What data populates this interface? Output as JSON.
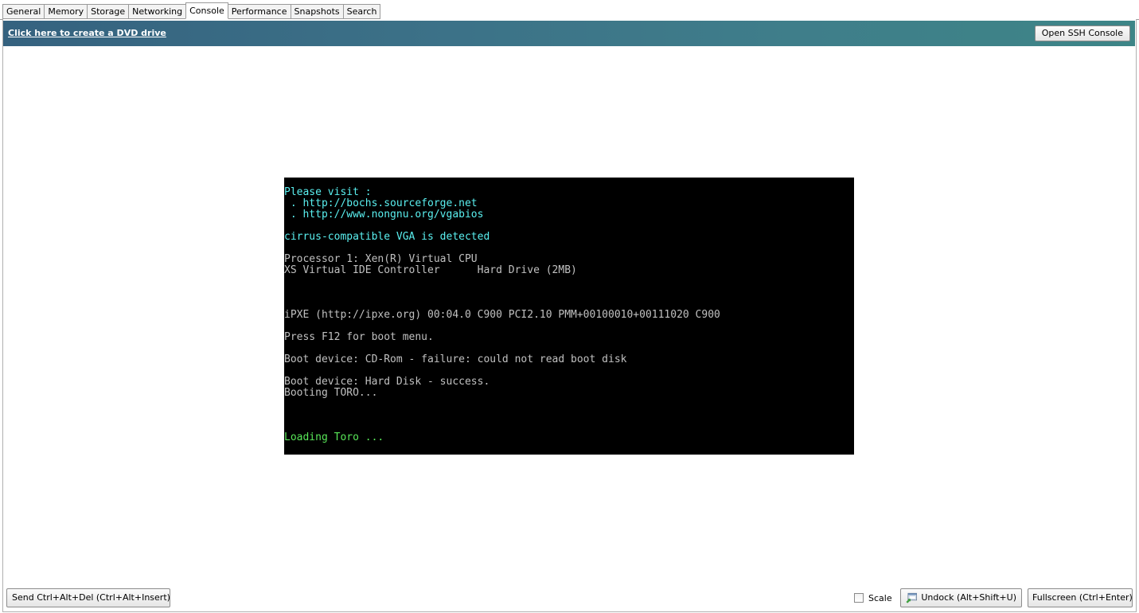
{
  "tabs": [
    {
      "label": "General",
      "active": false
    },
    {
      "label": "Memory",
      "active": false
    },
    {
      "label": "Storage",
      "active": false
    },
    {
      "label": "Networking",
      "active": false
    },
    {
      "label": "Console",
      "active": true
    },
    {
      "label": "Performance",
      "active": false
    },
    {
      "label": "Snapshots",
      "active": false
    },
    {
      "label": "Search",
      "active": false
    }
  ],
  "banner": {
    "link_text": "Click here to create a DVD drive",
    "ssh_button": "Open SSH Console",
    "colors": {
      "start": "#35627f",
      "end": "#3d8587"
    }
  },
  "console": {
    "lines": [
      {
        "text": "Please visit :",
        "color": "cyan"
      },
      {
        "text": " . http://bochs.sourceforge.net",
        "color": "cyan"
      },
      {
        "text": " . http://www.nongnu.org/vgabios",
        "color": "cyan"
      },
      {
        "text": "",
        "color": "gray"
      },
      {
        "text": "cirrus-compatible VGA is detected",
        "color": "cyan"
      },
      {
        "text": "",
        "color": "gray"
      },
      {
        "text": "Processor 1: Xen(R) Virtual CPU",
        "color": "gray"
      },
      {
        "text": "XS Virtual IDE Controller      Hard Drive (2MB)",
        "color": "gray"
      },
      {
        "text": "",
        "color": "gray"
      },
      {
        "text": "",
        "color": "gray"
      },
      {
        "text": "",
        "color": "gray"
      },
      {
        "text": "iPXE (http://ipxe.org) 00:04.0 C900 PCI2.10 PMM+00100010+00111020 C900",
        "color": "gray"
      },
      {
        "text": "",
        "color": "gray"
      },
      {
        "text": "Press F12 for boot menu.",
        "color": "gray"
      },
      {
        "text": "",
        "color": "gray"
      },
      {
        "text": "Boot device: CD-Rom - failure: could not read boot disk",
        "color": "gray"
      },
      {
        "text": "",
        "color": "gray"
      },
      {
        "text": "Boot device: Hard Disk - success.",
        "color": "gray"
      },
      {
        "text": "Booting TORO...",
        "color": "gray"
      },
      {
        "text": "",
        "color": "gray"
      },
      {
        "text": "",
        "color": "gray"
      },
      {
        "text": "",
        "color": "gray"
      },
      {
        "text": "Loading Toro ...",
        "color": "green"
      }
    ]
  },
  "bottom": {
    "send_button": "Send Ctrl+Alt+Del (Ctrl+Alt+Insert)",
    "scale_label": "Scale",
    "scale_checked": false,
    "undock_button": "Undock (Alt+Shift+U)",
    "undock_icon": "undock-window-icon",
    "fullscreen_button": "Fullscreen (Ctrl+Enter)"
  }
}
